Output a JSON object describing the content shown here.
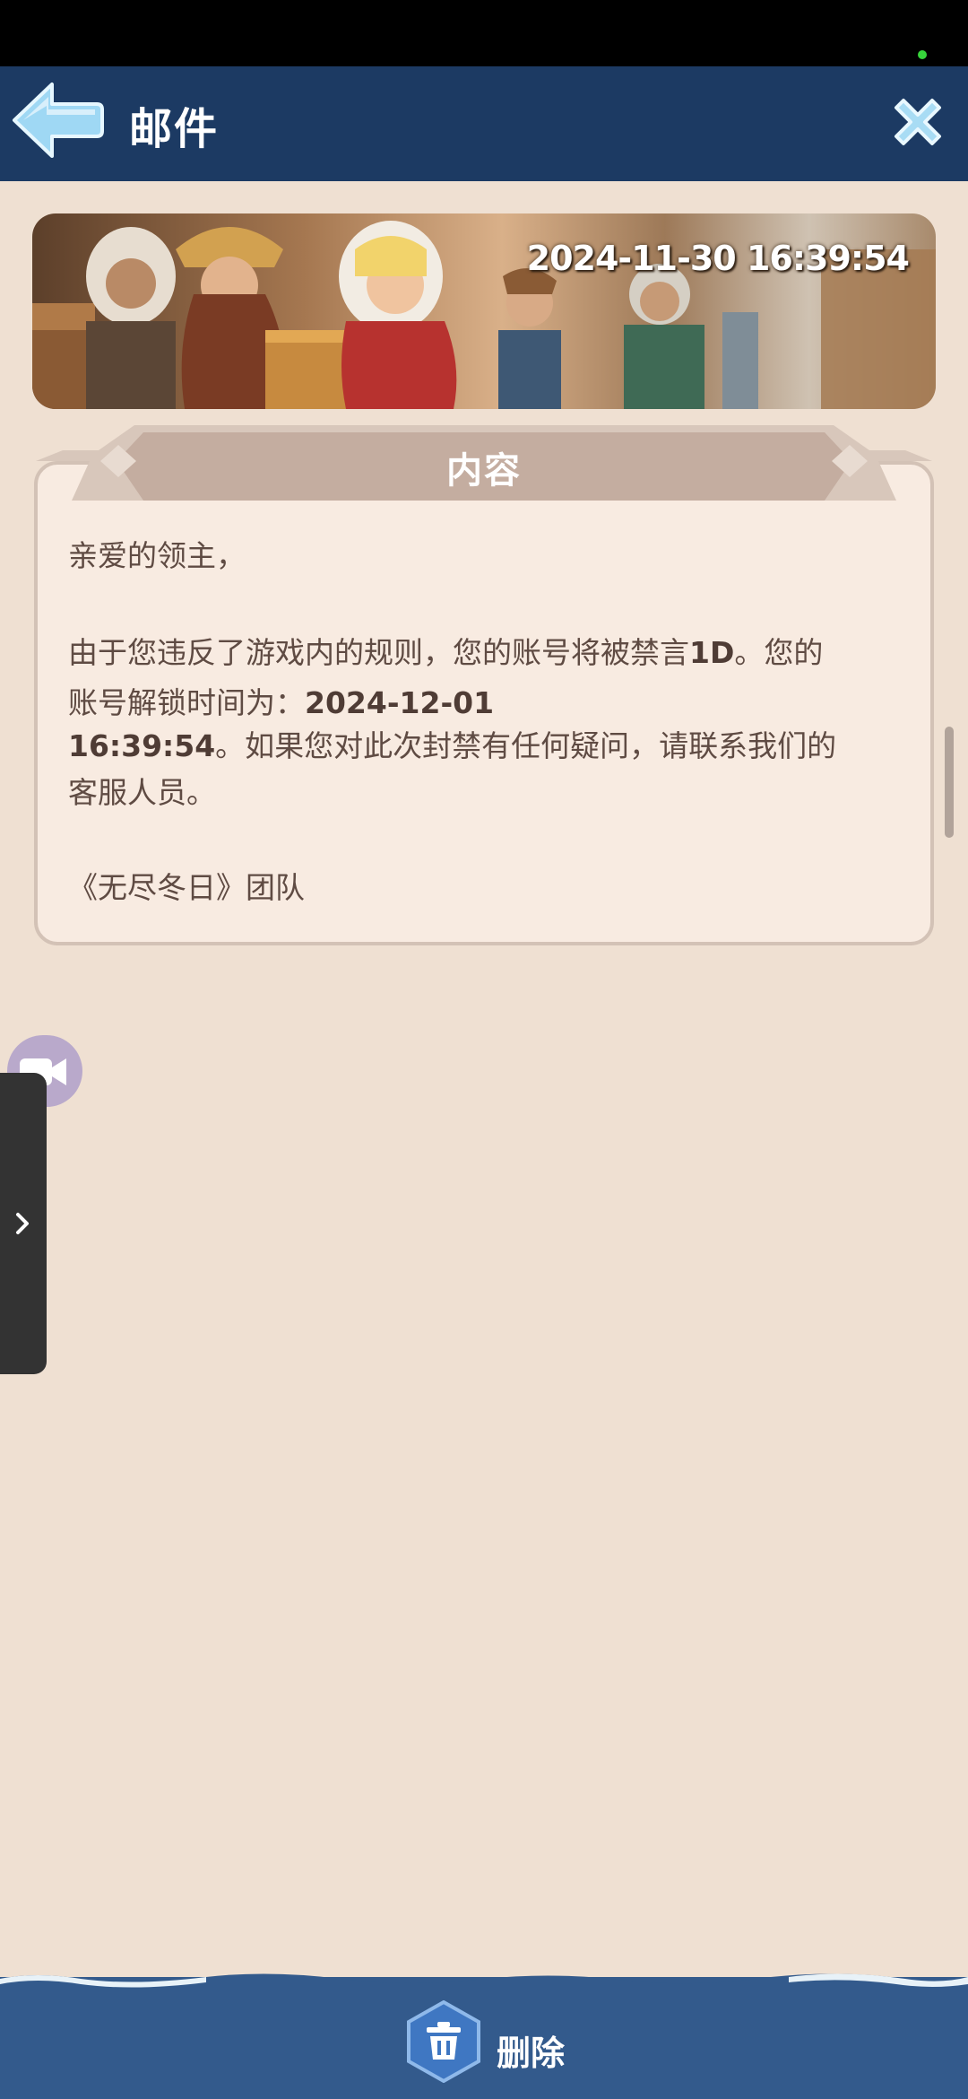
{
  "header": {
    "title": "邮件"
  },
  "banner": {
    "date": "2024-11-30 16:39:54"
  },
  "content": {
    "section_title": "内容",
    "greeting": "亲爱的领主，",
    "line1": "由于您违反了游戏内的规则，您的账号将被禁言",
    "line1_bold": "1D",
    "line1_end": "。您的",
    "line2": "账号解锁时间为：",
    "line2_bold": "2024-12-01",
    "line3_bold": "16:39:54",
    "line3": "。如果您对此次封禁有任何疑问，请联系我们的",
    "line4": "客服人员。",
    "signature": "《无尽冬日》团队"
  },
  "footer": {
    "delete_label": "删除"
  },
  "colors": {
    "header_bg": "#1c3a63",
    "page_bg": "#efe0d2",
    "panel_bg": "#f8ebe1",
    "footer_bg": "#335a8c",
    "text": "#5f4b43"
  },
  "icons": {
    "back": "back-arrow-icon",
    "close": "close-x-icon",
    "delete": "trash-icon",
    "camera": "video-camera-icon",
    "drawer": "chevron-right-icon"
  }
}
